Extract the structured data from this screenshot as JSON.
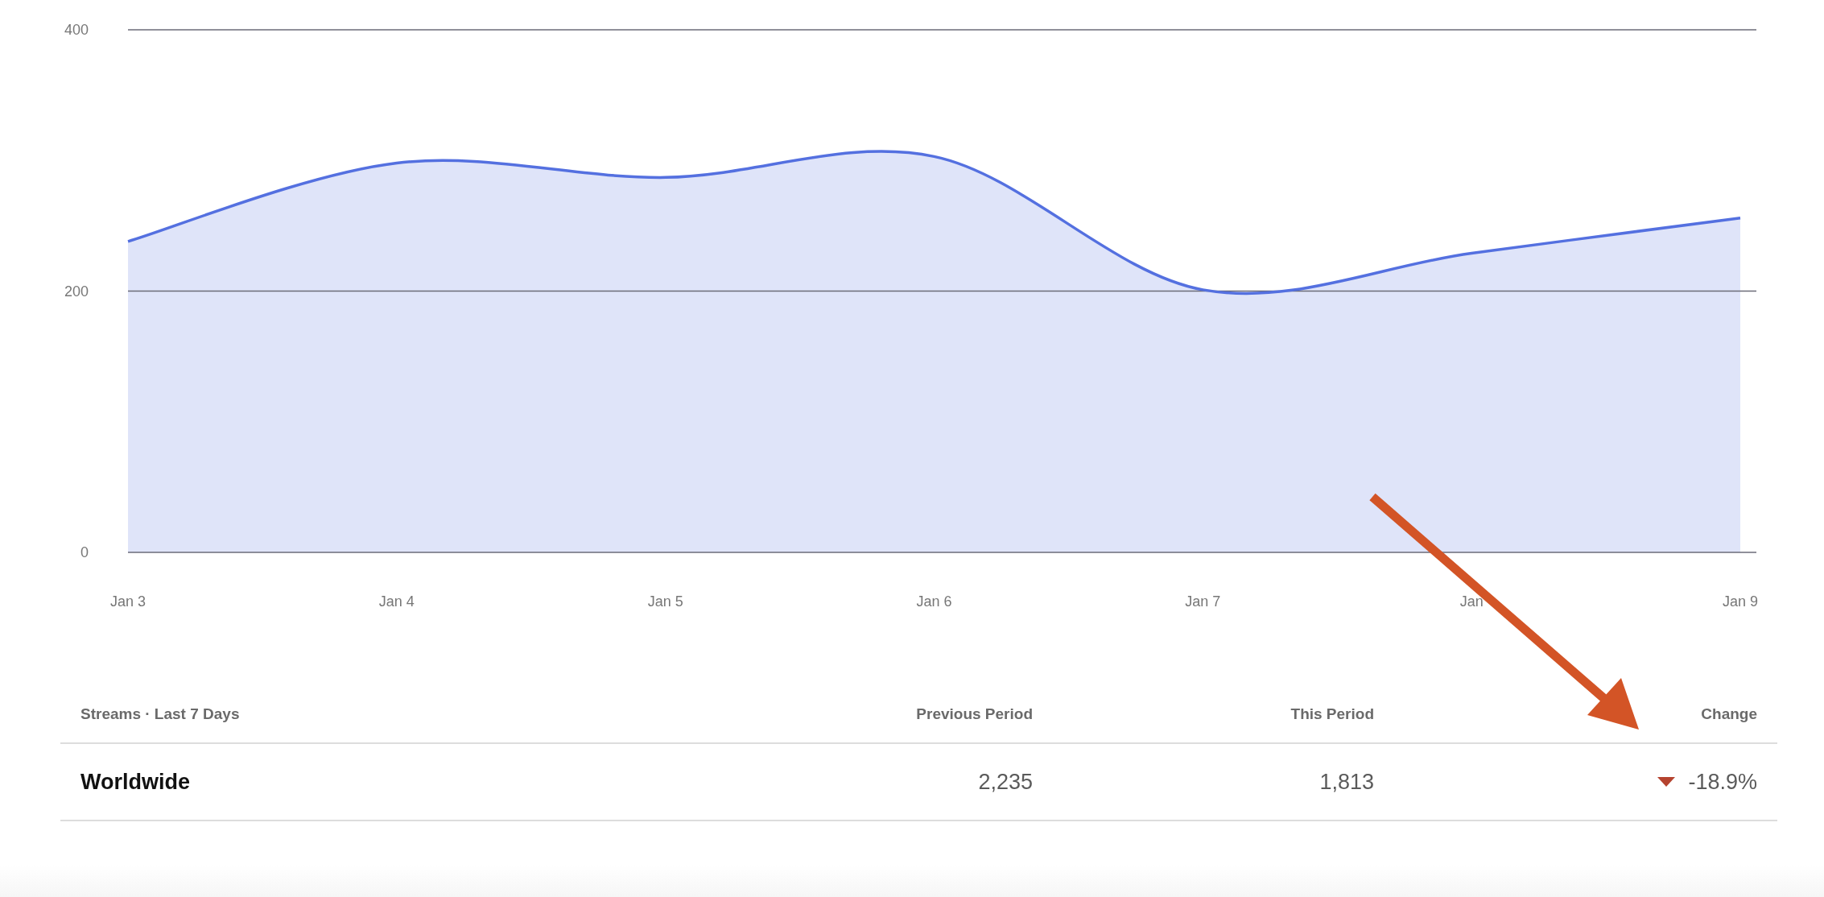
{
  "chart": {
    "chart_data": {
      "type": "area",
      "categories": [
        "Jan 3",
        "Jan 4",
        "Jan 5",
        "Jan 6",
        "Jan 7",
        "Jan",
        "Jan 9"
      ],
      "ylim": [
        0,
        400
      ],
      "yticks": [
        0,
        200,
        400
      ],
      "series": [
        {
          "color": "#5470e0",
          "values": [
            238,
            298,
            287,
            303,
            201,
            229,
            256
          ]
        }
      ]
    }
  },
  "table": {
    "columns": [
      "Streams · Last 7 Days",
      "Previous Period",
      "This Period",
      "Change"
    ],
    "rows": [
      {
        "region": "Worldwide",
        "previous": "2,235",
        "current": "1,813",
        "change": {
          "down": true,
          "text": "-18.9%"
        }
      }
    ]
  }
}
